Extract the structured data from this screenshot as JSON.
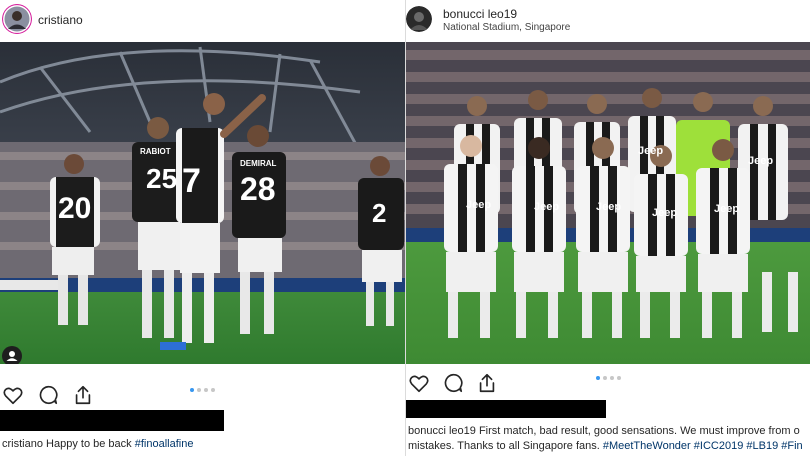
{
  "left_post": {
    "username": "cristiano",
    "caption_user": "cristiano",
    "caption_text": "Happy to be back",
    "hashtag": "#finoallafine",
    "carousel_dots": 4,
    "active_dot": 1,
    "jersey_numbers": [
      "20",
      "25",
      "7",
      "28",
      "2"
    ],
    "jersey_names": [
      "RABIOT",
      "DEMIRAL"
    ]
  },
  "right_post": {
    "username": "bonucci leo19",
    "location": "National Stadium, Singapore",
    "caption_user": "bonucci leo19",
    "caption_line1": "First match, bad result, good sensations. We must improve from o",
    "caption_line2_text": "mistakes. Thanks to all Singapore fans.",
    "hashtags": [
      "#MeetTheWonder",
      "#ICC2019",
      "#LB19",
      "#Fin"
    ],
    "carousel_dots": 4,
    "active_dot": 1,
    "jersey_sponsor": "Jeep"
  },
  "colors": {
    "link": "#003569",
    "active_dot": "#3897f0",
    "inactive_dot": "#c7c7c7"
  },
  "icons": [
    "heart-icon",
    "comment-icon",
    "share-icon",
    "profile-tag-icon"
  ]
}
